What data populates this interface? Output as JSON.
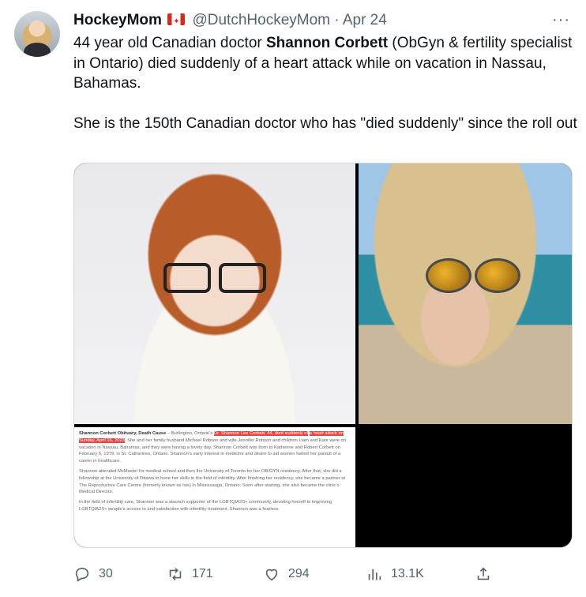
{
  "tweet": {
    "author_name": "HockeyMom",
    "handle": "@DutchHockeyMom",
    "separator": "·",
    "date": "Apr 24",
    "text_part1": "44 year old Canadian doctor ",
    "text_bold": "Shannon Corbett",
    "text_part2": " (ObGyn & fertility specialist in Ontario) died suddenly of a heart attack while on vacation in Nassau, Bahamas.\n\nShe is the 150th Canadian doctor who has \"died suddenly\" since the roll out"
  },
  "article": {
    "title": "Shannon Corbett Obituary, Death Cause",
    "lead_plain": " – Burlington, Ontario’s ",
    "highlight1": "Dr. Shannon Lee Corbett, 44, died suddenly of",
    "highlight2": "a heart attack on Sunday, April 16, 2023",
    "p1_rest": ". She and her family husband Michael Robson and wife Jennifer Robson and children Liam and Kate were on vacation in Nassau, Bahamas, and they were having a lovely day. Shannon Corbett was born to Katherine and Robert Corbett on February 6, 1979, in St. Catharines, Ontario. Shannon’s early interest in medicine and desire to aid women fueled her pursuit of a career in healthcare.",
    "p2": "Shannon attended McMaster for medical school and then the University of Toronto for her OB/GYN residency. After that, she did a fellowship at the University of Ottawa to hone her skills in the field of infertility. After finishing her residency, she became a partner at The Reproductive Care Centre (formerly known as Isis) in Mississauga, Ontario. Soon after starting, she also became the clinic’s Medical Director.",
    "p3": "In the field of infertility care, Shannon was a staunch supporter of the LGBTQIA2S+ community, devoting herself to improving LGBTQIA2S+ people’s access to and satisfaction with infertility treatment. Shannon was a fearless"
  },
  "actions": {
    "replies": "30",
    "retweets": "171",
    "likes": "294",
    "views": "13.1K"
  },
  "icons": [
    "more-icon",
    "reply-icon",
    "retweet-icon",
    "like-icon",
    "views-icon",
    "share-icon"
  ],
  "colors": {
    "text": "#0f1419",
    "secondary": "#536471",
    "border": "#cfd9de",
    "highlight": "#e8433f"
  }
}
